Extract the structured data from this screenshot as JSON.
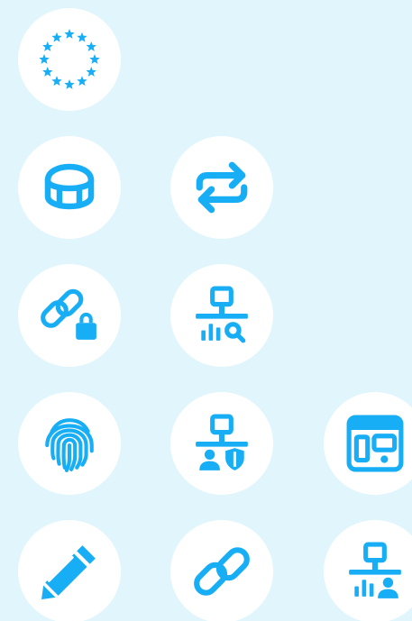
{
  "colors": {
    "background": "#e0f5fc",
    "tile": "#ffffff",
    "icon": "#18aef5"
  },
  "icons": [
    "european-union-icon",
    "arena-stadium-icon",
    "sync-arrows-icon",
    "link-lock-icon",
    "network-analytics-search-icon",
    "fingerprint-icon",
    "network-user-shield-icon",
    "dashboard-window-icon",
    "pencil-icon",
    "link-icon",
    "network-analytics-user-icon"
  ]
}
